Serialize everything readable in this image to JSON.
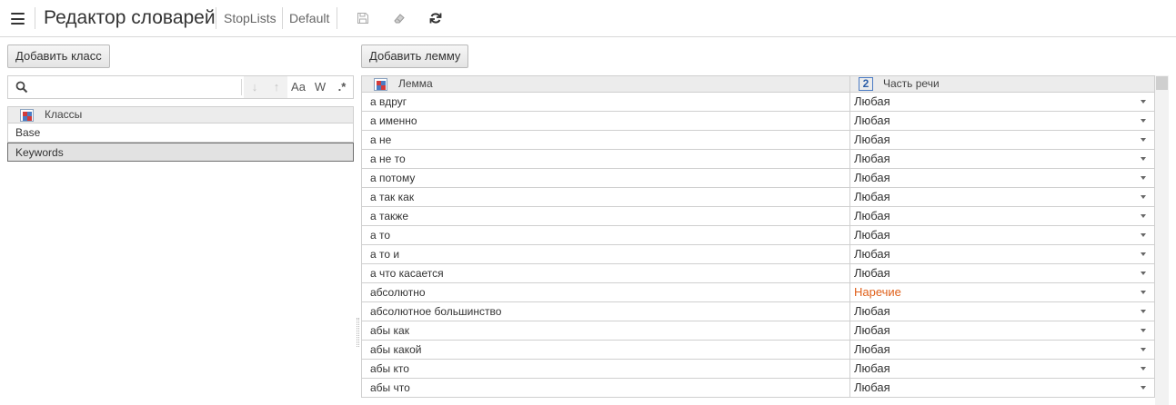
{
  "header": {
    "title": "Редактор словарей",
    "breadcrumbs": [
      "StopLists",
      "Default"
    ],
    "tools": [
      "save-icon",
      "eraser-icon",
      "refresh-icon"
    ]
  },
  "left": {
    "add_button": "Добавить класс",
    "search": {
      "value": "",
      "tools": {
        "down": "↓",
        "up": "↑",
        "case": "Aa",
        "word": "W",
        "regex": ".*"
      }
    },
    "classes": {
      "header": "Классы",
      "rows": [
        {
          "name": "Base",
          "selected": false
        },
        {
          "name": "Keywords",
          "selected": true
        }
      ]
    }
  },
  "right": {
    "add_button": "Добавить лемму",
    "table": {
      "col_lemma": "Лемма",
      "col_pos": "Часть речи",
      "rows": [
        {
          "lemma": "а вдруг",
          "pos": "Любая"
        },
        {
          "lemma": "а именно",
          "pos": "Любая"
        },
        {
          "lemma": "а не",
          "pos": "Любая"
        },
        {
          "lemma": "а не то",
          "pos": "Любая"
        },
        {
          "lemma": "а потому",
          "pos": "Любая"
        },
        {
          "lemma": "а так как",
          "pos": "Любая"
        },
        {
          "lemma": "а также",
          "pos": "Любая"
        },
        {
          "lemma": "а то",
          "pos": "Любая"
        },
        {
          "lemma": "а то и",
          "pos": "Любая"
        },
        {
          "lemma": "а что касается",
          "pos": "Любая"
        },
        {
          "lemma": "абсолютно",
          "pos": "Наречие",
          "highlight": true
        },
        {
          "lemma": "абсолютное большинство",
          "pos": "Любая"
        },
        {
          "lemma": "абы как",
          "pos": "Любая"
        },
        {
          "lemma": "абы какой",
          "pos": "Любая"
        },
        {
          "lemma": "абы кто",
          "pos": "Любая"
        },
        {
          "lemma": "абы что",
          "pos": "Любая"
        }
      ]
    }
  },
  "colors": {
    "accent": "#e0611b"
  }
}
